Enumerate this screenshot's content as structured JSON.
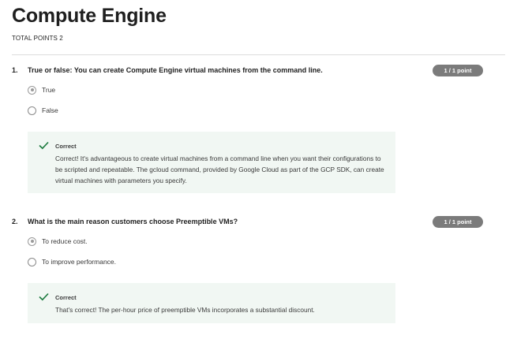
{
  "page": {
    "title": "Compute Engine",
    "total_points": "TOTAL POINTS 2"
  },
  "questions": [
    {
      "number": "1.",
      "text": "True or false: You can create Compute Engine virtual machines from the command line.",
      "points": "1 / 1 point",
      "options": [
        {
          "label": "True",
          "selected": true
        },
        {
          "label": "False",
          "selected": false
        }
      ],
      "feedback": {
        "status": "Correct",
        "icon": "checkmark-icon",
        "text": "Correct! It's advantageous to create virtual machines from a command line when you want their configurations to be scripted and repeatable. The gcloud command, provided by Google Cloud as part of the GCP SDK, can create virtual machines with parameters you specify."
      }
    },
    {
      "number": "2.",
      "text": "What is the main reason customers choose Preemptible VMs?",
      "points": "1 / 1 point",
      "options": [
        {
          "label": "To reduce cost.",
          "selected": true
        },
        {
          "label": "To improve performance.",
          "selected": false
        }
      ],
      "feedback": {
        "status": "Correct",
        "icon": "checkmark-icon",
        "text": "That's correct! The per-hour price of preemptible VMs incorporates a substantial discount."
      }
    }
  ],
  "colors": {
    "badge": "#7b7b7b",
    "feedback_bg": "#f1f7f3",
    "check": "#1b7a3e"
  }
}
